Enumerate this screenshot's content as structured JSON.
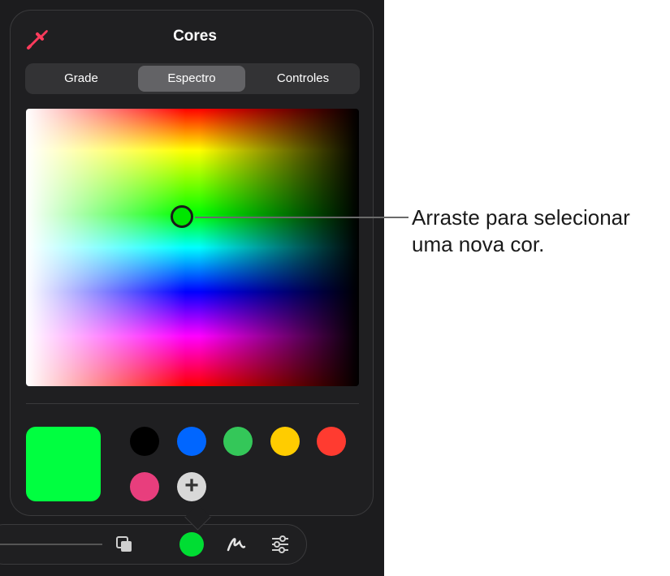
{
  "popover": {
    "title": "Cores",
    "tabs": [
      {
        "label": "Grade"
      },
      {
        "label": "Espectro",
        "selected": true
      },
      {
        "label": "Controles"
      }
    ]
  },
  "callout": {
    "text": "Arraste para selecionar uma nova cor."
  },
  "current_color": "#00ff40",
  "swatches": [
    {
      "name": "black",
      "color": "#000000"
    },
    {
      "name": "blue",
      "color": "#0066ff"
    },
    {
      "name": "green",
      "color": "#34c759"
    },
    {
      "name": "yellow",
      "color": "#ffcc00"
    },
    {
      "name": "red",
      "color": "#ff3b30"
    },
    {
      "name": "pink",
      "color": "#e83e7d"
    }
  ],
  "icons": {
    "eyedropper": "eyedropper-icon",
    "add": "plus-icon",
    "layers": "layers-icon",
    "pen": "pen-icon",
    "settings": "sliders-icon"
  },
  "toolbar": {
    "selected_color": "#00dd33"
  }
}
